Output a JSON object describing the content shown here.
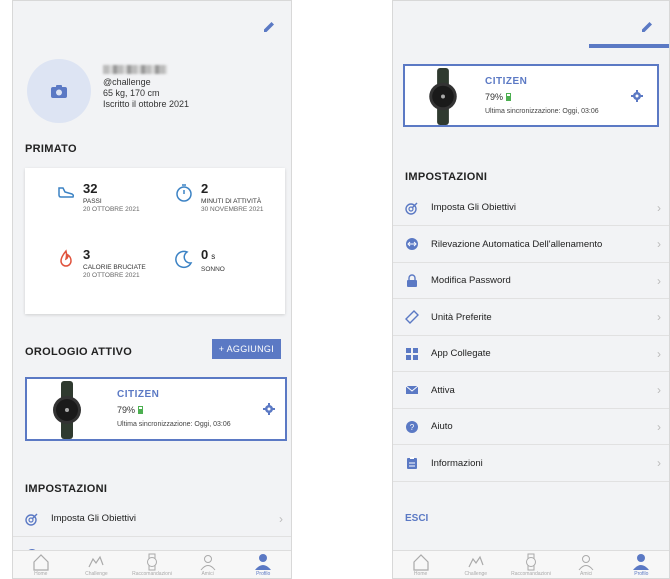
{
  "left": {
    "profile": {
      "handle": "@challenge",
      "stats_line": "65 kg, 170 cm",
      "joined": "Iscritto il ottobre 2021"
    },
    "records": {
      "title": "PRIMATO",
      "steps": {
        "value": "32",
        "label": "PASSI",
        "date": "20 OTTOBRE 2021"
      },
      "activity": {
        "value": "2",
        "label": "MINUTI DI ATTIVITÀ",
        "date": "30 NOVEMBRE 2021"
      },
      "calories": {
        "value": "3",
        "label": "CALORIE BRUCIATE",
        "date": "20 OTTOBRE 2021"
      },
      "sleep": {
        "value": "0",
        "unit": "s",
        "label": "SONNO"
      }
    },
    "watch_section": {
      "title": "OROLOGIO ATTIVO",
      "add_label": "+ AGGIUNGI"
    },
    "settings_title": "IMPOSTAZIONI",
    "settings_first": "Imposta Gli Obiettivi"
  },
  "watch": {
    "name": "CITIZEN",
    "battery": "79%",
    "battery_level": 0.79,
    "sync": "Ultima sincronizzazione: Oggi, 03:06"
  },
  "right": {
    "settings_title": "IMPOSTAZIONI",
    "items": [
      {
        "label": "Imposta Gli Obiettivi",
        "icon": "goal-icon"
      },
      {
        "label": "Rilevazione Automatica Dell'allenamento",
        "icon": "auto-detect-icon"
      },
      {
        "label": "Modifica Password",
        "icon": "lock-icon"
      },
      {
        "label": "Unità Preferite",
        "icon": "ruler-icon"
      },
      {
        "label": "App Collegate",
        "icon": "apps-grid-icon"
      },
      {
        "label": "Attiva",
        "icon": "mail-icon"
      },
      {
        "label": "Aiuto",
        "icon": "help-icon"
      },
      {
        "label": "Informazioni",
        "icon": "clipboard-icon"
      }
    ],
    "logout": "ESCI"
  },
  "tabs": [
    "Home",
    "Challenge",
    "Raccomandazioni",
    "Amici",
    "Profilo"
  ],
  "colors": {
    "accent": "#5b79c4",
    "steps": "#3b82c4",
    "calories": "#e0533d",
    "battery": "#4caf50"
  }
}
